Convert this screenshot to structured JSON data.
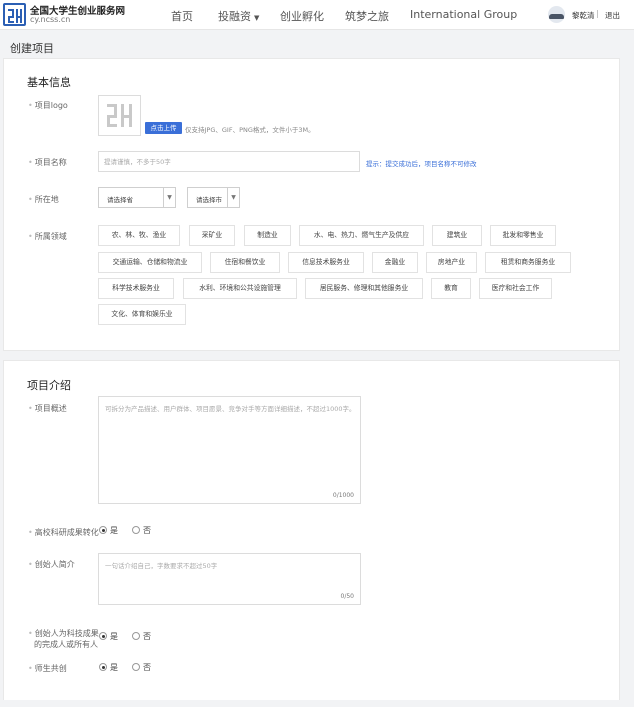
{
  "header": {
    "site_name": "全国大学生创业服务网",
    "site_url": "cy.ncss.cn",
    "nav": [
      {
        "label": "首页",
        "dropdown": false
      },
      {
        "label": "投融资",
        "dropdown": true
      },
      {
        "label": "创业孵化",
        "dropdown": false
      },
      {
        "label": "筑梦之旅",
        "dropdown": false
      },
      {
        "label": "International Group",
        "dropdown": false
      }
    ],
    "user_name": "黎乾清",
    "separator": "|",
    "logout": "退出"
  },
  "page_title": "创建项目",
  "basic_info": {
    "title": "基本信息",
    "logo_label": "项目logo",
    "upload_button": "点击上传",
    "upload_hint": "仅支持JPG、GIF、PNG格式，文件小于3M。",
    "name_label": "项目名称",
    "name_placeholder": "提请谨慎，不多于50字",
    "name_tip": "提示：提交成功后，项目名称不可修改",
    "location_label": "所在地",
    "province_placeholder": "请选择省",
    "city_placeholder": "请选择市",
    "industry_label": "所属领域",
    "industries": [
      "农、林、牧、渔业",
      "采矿业",
      "制造业",
      "水、电、热力、燃气生产及供应",
      "建筑业",
      "批发和零售业",
      "交通运输、仓储和物流业",
      "住宿和餐饮业",
      "信息技术服务业",
      "金融业",
      "房地产业",
      "租赁和商务服务业",
      "科学技术服务业",
      "水利、环境和公共设施管理",
      "居民服务、修理和其他服务业",
      "教育",
      "医疗和社会工作",
      "文化、体育和娱乐业"
    ]
  },
  "intro": {
    "title": "项目介绍",
    "overview_label": "项目概述",
    "overview_placeholder": "可拆分为产品描述、用户群体、项目愿景、竞争对手等方面详细描述，不超过1000字。",
    "overview_count": "0/1000",
    "tech_transfer_label": "高校科研成果转化",
    "yes": "是",
    "no": "否",
    "founder_label": "创始人简介",
    "founder_placeholder": "一句话介绍自己，字数要求不超过50字",
    "founder_count": "0/50",
    "founder_owner_label_1": "创始人为科技成果",
    "founder_owner_label_2": "的完成人或所有人",
    "teacher_student_label": "师生共创"
  },
  "colors": {
    "accent": "#3a6fd8",
    "logo_blue": "#2b5fb4"
  }
}
